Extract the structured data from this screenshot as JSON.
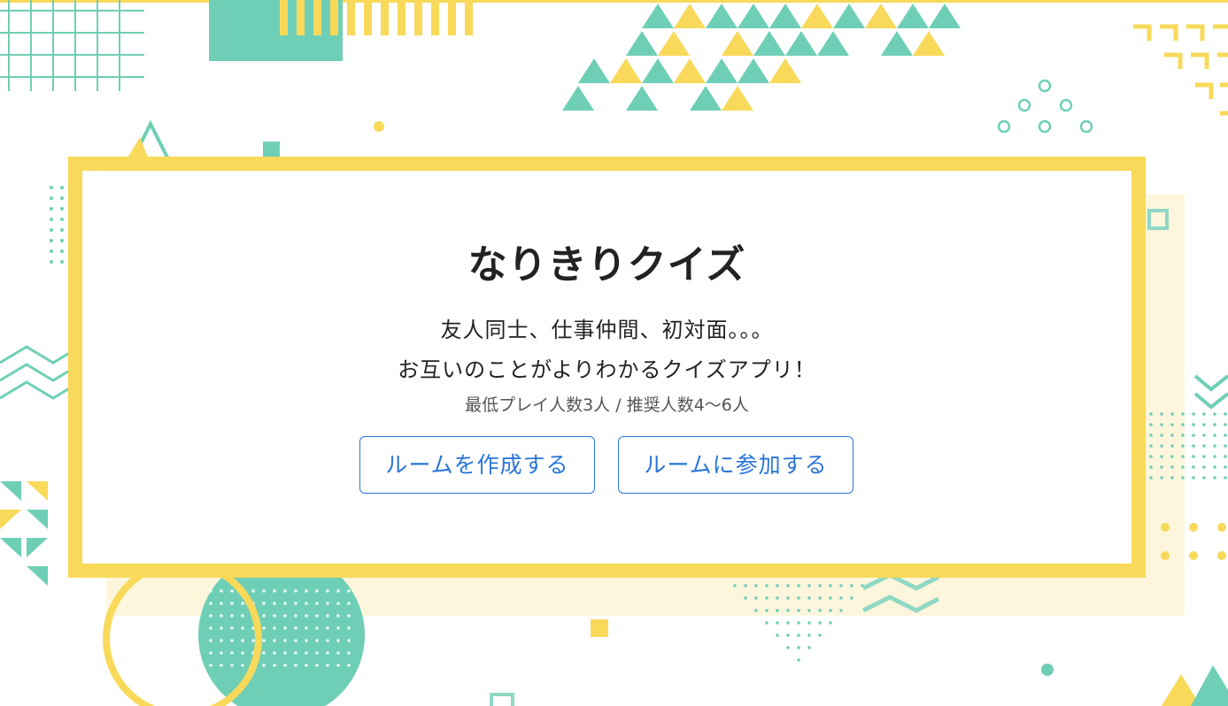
{
  "app": {
    "title": "なりきりクイズ",
    "tagline_line1": "友人同士、仕事仲間、初対面。。。",
    "tagline_line2": "お互いのことがよりわかるクイズアプリ！",
    "players_info": "最低プレイ人数3人 / 推奨人数4〜6人"
  },
  "actions": {
    "create_room_label": "ルームを作成する",
    "join_room_label": "ルームに参加する"
  },
  "colors": {
    "accent_yellow": "#f8d95a",
    "accent_teal": "#6fcfb6",
    "pale_yellow": "#fdf6dc",
    "button_blue": "#2a76d8"
  }
}
